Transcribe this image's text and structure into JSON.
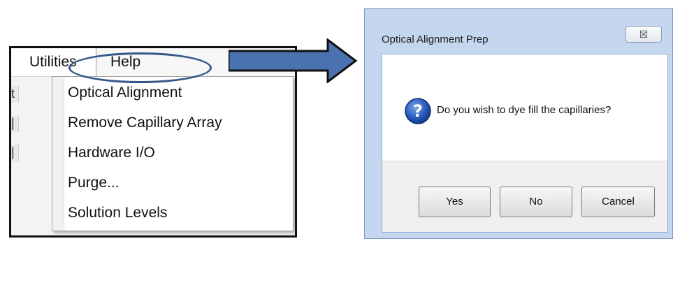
{
  "menu": {
    "bar_items": [
      "Utilities",
      "Help"
    ],
    "dropdown_items": [
      "Optical Alignment",
      "Remove Capillary Array",
      "Hardware I/O",
      "Purge...",
      "Solution Levels"
    ],
    "edge_fragments": [
      "t",
      "|",
      "|"
    ]
  },
  "dialog": {
    "title": "Optical Alignment Prep",
    "close_glyph": "☒",
    "icon": "question-icon",
    "icon_glyph": "?",
    "message": "Do you wish to dye fill the capillaries?",
    "buttons": {
      "yes": "Yes",
      "no": "No",
      "cancel": "Cancel"
    }
  },
  "annotation": {
    "arrow_color": "#4a72b0",
    "ellipse_color": "#35588a"
  }
}
